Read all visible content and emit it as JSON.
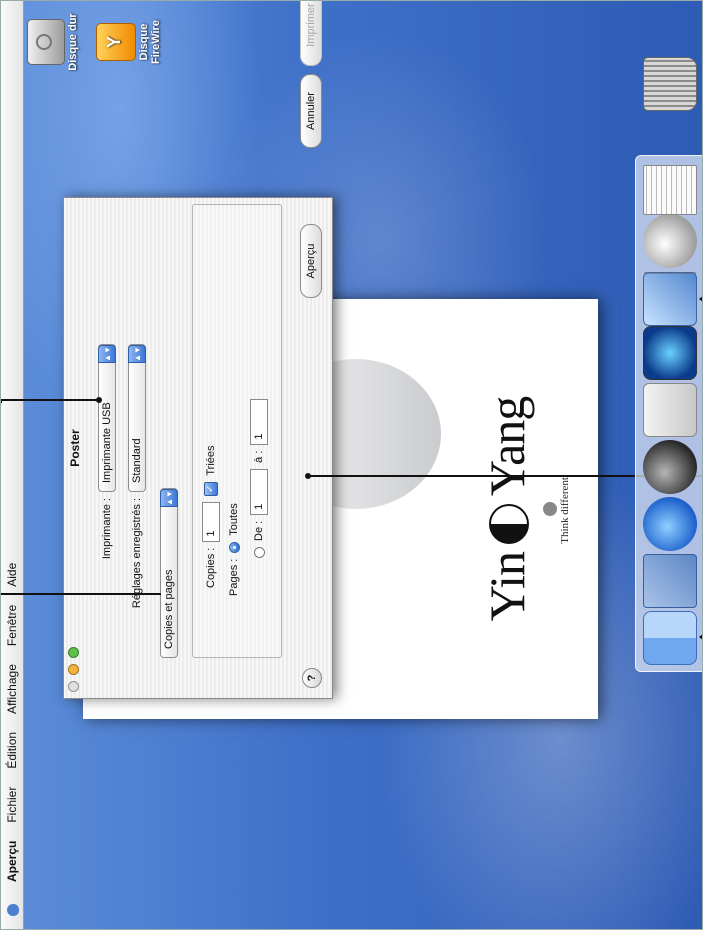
{
  "menubar": {
    "app_name": "Aperçu",
    "items": [
      "Fichier",
      "Édition",
      "Affichage",
      "Fenêtre",
      "Aide"
    ]
  },
  "desktop": {
    "icons": [
      {
        "label": "Disque dur",
        "icon": "hard-drive-icon"
      },
      {
        "label": "Disque FireWire",
        "icon": "firewire-drive-icon"
      }
    ]
  },
  "poster": {
    "title_left": "Yin",
    "title_right": "Yang",
    "tagline": "Think different."
  },
  "print_sheet": {
    "title": "Poster",
    "printer_label": "Imprimante :",
    "printer_value": "Imprimante USB",
    "presets_label": "Réglages enregistrés :",
    "presets_value": "Standard",
    "panel_value": "Copies et pages",
    "copies_label": "Copies :",
    "copies_value": "1",
    "collated_label": "Triées",
    "collated_checked": true,
    "pages_label": "Pages :",
    "all_label": "Toutes",
    "from_label": "De :",
    "from_value": "1",
    "to_label": "à :",
    "to_value": "1",
    "help_label": "?",
    "preview_button": "Aperçu",
    "cancel_button": "Annuler",
    "print_button": "Imprimer",
    "print_enabled": false
  },
  "dock": {
    "items": [
      "finder-icon",
      "mail-icon",
      "internet-explorer-icon",
      "sherlock-icon",
      "system-preferences-icon",
      "quicktime-icon",
      "iphoto-icon",
      "at-sign-icon",
      "newspaper-icon",
      "trash-icon"
    ]
  },
  "colors": {
    "desktop": "#3f70c8",
    "accent": "#3a77d8"
  }
}
